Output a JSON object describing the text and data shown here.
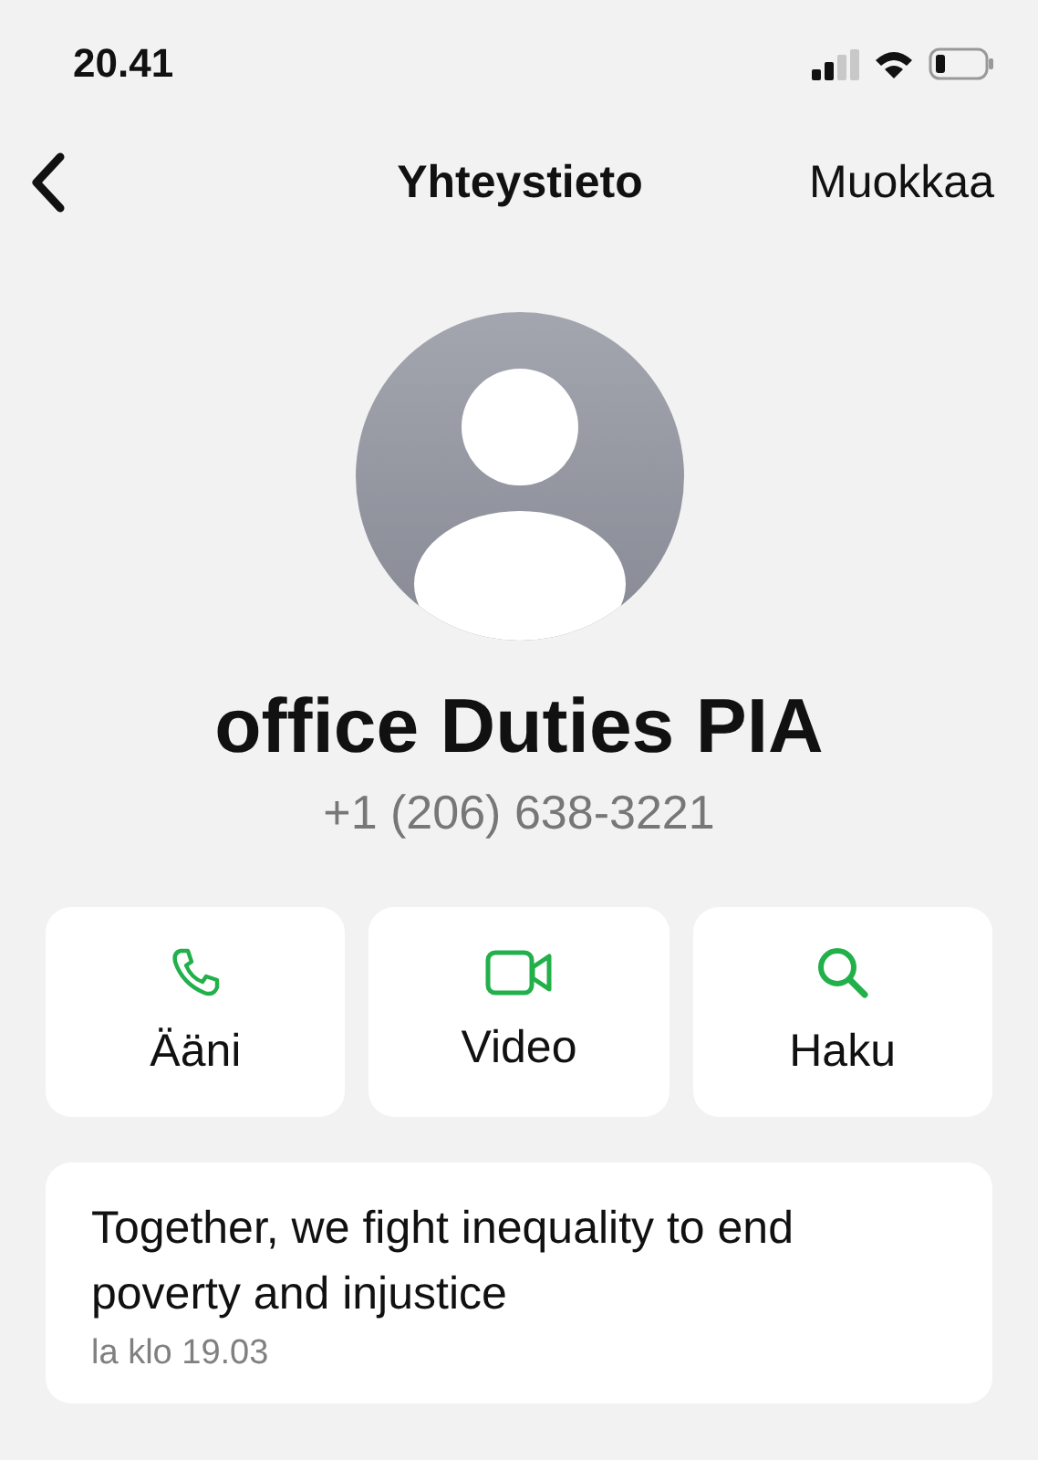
{
  "status_bar": {
    "time": "20.41"
  },
  "nav": {
    "title": "Yhteystieto",
    "edit": "Muokkaa"
  },
  "contact": {
    "name": "office Duties PIA",
    "phone": "+1 (206) 638-3221"
  },
  "actions": [
    {
      "kind": "phone",
      "label": "Ääni"
    },
    {
      "kind": "video",
      "label": "Video"
    },
    {
      "kind": "search",
      "label": "Haku"
    }
  ],
  "message": {
    "text": "Together, we fight inequality to end poverty and injustice",
    "time": "la klo 19.03"
  }
}
